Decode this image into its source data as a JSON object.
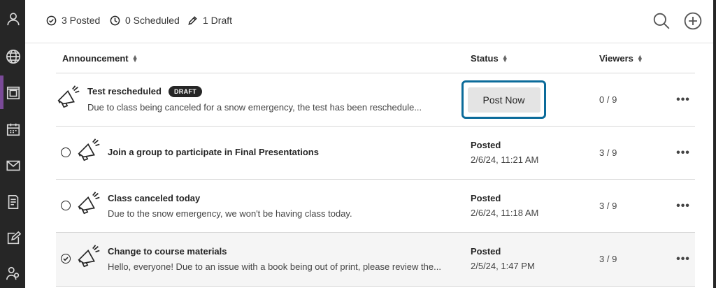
{
  "sidebar": {
    "items": [
      {
        "icon": "person-icon"
      },
      {
        "icon": "globe-icon"
      },
      {
        "icon": "course-icon"
      },
      {
        "icon": "calendar-icon"
      },
      {
        "icon": "mail-icon"
      },
      {
        "icon": "grades-icon"
      },
      {
        "icon": "edit-icon"
      },
      {
        "icon": "people-icon"
      }
    ],
    "active_color": "#7a4a98"
  },
  "toolbar": {
    "posted_count": "3 Posted",
    "scheduled_count": "0 Scheduled",
    "draft_count": "1 Draft",
    "search_icon": "search-icon",
    "add_icon": "plus-circle-icon"
  },
  "table": {
    "headers": {
      "announcement": "Announcement",
      "status": "Status",
      "viewers": "Viewers"
    },
    "rows": [
      {
        "title": "Test rescheduled",
        "badge": "DRAFT",
        "description": "Due to class being canceled for a snow emergency, the test has been reschedule...",
        "status_button": "Post Now",
        "viewers": "0 / 9"
      },
      {
        "title": "Join a group to participate in Final Presentations",
        "status": "Posted",
        "date": "2/6/24, 11:21 AM",
        "viewers": "3 / 9"
      },
      {
        "title": "Class canceled today",
        "description": "Due to the snow emergency, we won't be having class today.",
        "status": "Posted",
        "date": "2/6/24, 11:18 AM",
        "viewers": "3 / 9"
      },
      {
        "title": "Change to course materials",
        "description": "Hello, everyone! Due to an issue with a book being out of print, please review the...",
        "status": "Posted",
        "date": "2/5/24, 1:47 PM",
        "viewers": "3 / 9"
      }
    ],
    "more_label": "•••"
  },
  "colors": {
    "focus_ring": "#0b6b9a",
    "sidebar_bg": "#262626"
  }
}
